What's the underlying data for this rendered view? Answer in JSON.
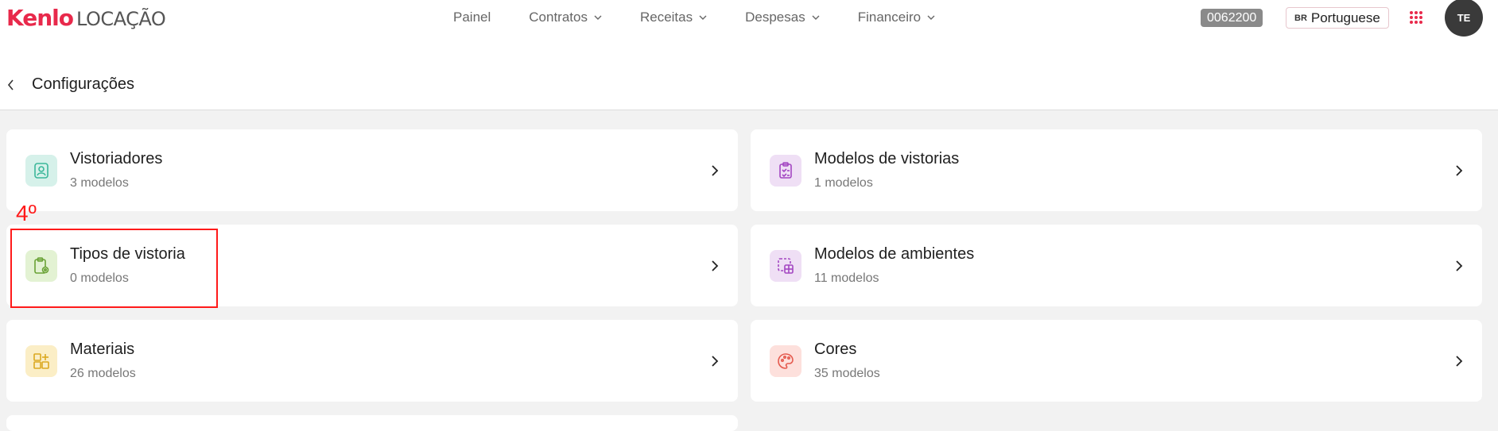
{
  "header": {
    "brand": "Kenlo",
    "product": "LOCAÇÃO",
    "nav": [
      {
        "label": "Painel",
        "dropdown": false
      },
      {
        "label": "Contratos",
        "dropdown": true
      },
      {
        "label": "Receitas",
        "dropdown": true
      },
      {
        "label": "Despesas",
        "dropdown": true
      },
      {
        "label": "Financeiro",
        "dropdown": true
      }
    ],
    "code": "0062200",
    "lang_flag": "BR",
    "lang_label": "Portuguese",
    "avatar_initials": "TE"
  },
  "page": {
    "title": "Configurações"
  },
  "cards": [
    {
      "title": "Vistoriadores",
      "sub": "3 modelos",
      "icon": "inspector-icon",
      "color": "#3bb79a",
      "bg": "#d6f1ea"
    },
    {
      "title": "Modelos de vistorias",
      "sub": "1 modelos",
      "icon": "clipboard-check-icon",
      "color": "#a347c2",
      "bg": "#efdff5"
    },
    {
      "title": "Tipos de vistoria",
      "sub": "0 modelos",
      "icon": "clipboard-gear-icon",
      "color": "#6aa236",
      "bg": "#e3f2d3"
    },
    {
      "title": "Modelos de ambientes",
      "sub": "11 modelos",
      "icon": "room-layout-icon",
      "color": "#a347c2",
      "bg": "#efdff5"
    },
    {
      "title": "Materiais",
      "sub": "26 modelos",
      "icon": "materials-grid-icon",
      "color": "#dba820",
      "bg": "#fbeec6"
    },
    {
      "title": "Cores",
      "sub": "35 modelos",
      "icon": "palette-icon",
      "color": "#e55a4e",
      "bg": "#fde0dc"
    }
  ],
  "annotation": {
    "label": "4º",
    "color": "#ff1a1a"
  }
}
